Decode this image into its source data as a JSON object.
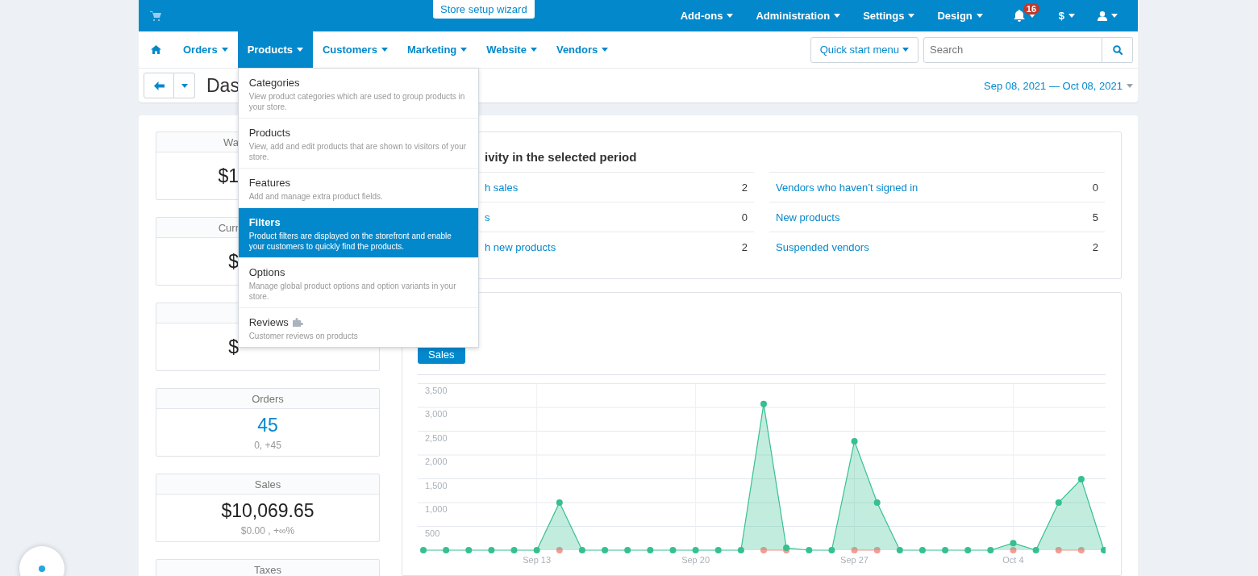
{
  "top_bar": {
    "wizard": "Store setup wizard",
    "menus": [
      {
        "label": "Add-ons"
      },
      {
        "label": "Administration"
      },
      {
        "label": "Settings"
      },
      {
        "label": "Design"
      }
    ],
    "notifications": "16",
    "currency": "$"
  },
  "nav": {
    "items": [
      {
        "label": "Orders",
        "selected": false
      },
      {
        "label": "Products",
        "selected": true
      },
      {
        "label": "Customers",
        "selected": false
      },
      {
        "label": "Marketing",
        "selected": false
      },
      {
        "label": "Website",
        "selected": false
      },
      {
        "label": "Vendors",
        "selected": false
      }
    ],
    "quick_start": "Quick start menu",
    "search": {
      "placeholder": "Search"
    }
  },
  "dropdown": [
    {
      "title": "Categories",
      "description": "View product categories which are used to group products in your store.",
      "selected": false,
      "addon": false
    },
    {
      "title": "Products",
      "description": "View, add and edit products that are shown to visitors of your store.",
      "selected": false,
      "addon": false
    },
    {
      "title": "Features",
      "description": "Add and manage extra product fields.",
      "selected": false,
      "addon": false
    },
    {
      "title": "Filters",
      "description": "Product filters are displayed on the storefront and enable your customers to quickly find the products.",
      "selected": true,
      "addon": false
    },
    {
      "title": "Options",
      "description": "Manage global product options and option variants in your store.",
      "selected": false,
      "addon": false
    },
    {
      "title": "Reviews",
      "description": "Customer reviews on products",
      "selected": false,
      "addon": true
    }
  ],
  "header": {
    "title": "Das",
    "date_range": "Sep 08, 2021 — Oct 08, 2021"
  },
  "stat_cards": [
    {
      "kind": "partial",
      "title": "Wa",
      "value": "$1",
      "link": false
    },
    {
      "kind": "partial",
      "title": "Curr",
      "value": "$",
      "link": false
    },
    {
      "kind": "partial",
      "value": "$",
      "link": false
    },
    {
      "kind": "full",
      "title": "Orders",
      "value": "45",
      "sub": "0, +45",
      "link": true
    },
    {
      "kind": "full",
      "title": "Sales",
      "value": "$10,069.65",
      "sub": "$0.00 , +∞%",
      "link": false
    },
    {
      "kind": "full",
      "title": "Taxes"
    }
  ],
  "activity": {
    "title": "ivity in the selected period",
    "columns": [
      [
        {
          "label": "h sales",
          "value": "2"
        },
        {
          "label": "s",
          "value": "0"
        },
        {
          "label": "h new products",
          "value": "2"
        }
      ],
      [
        {
          "label": "Vendors who haven’t signed in",
          "value": "0"
        },
        {
          "label": "New products",
          "value": "5"
        },
        {
          "label": "Suspended vendors",
          "value": "2"
        }
      ]
    ]
  },
  "chart_panel": {
    "tabs": [
      {
        "label": "Sales",
        "selected": true
      }
    ],
    "chart_data": {
      "type": "area",
      "categories": [
        null,
        null,
        null,
        null,
        null,
        "Sep 13",
        null,
        null,
        null,
        null,
        null,
        null,
        "Sep 20",
        null,
        null,
        null,
        null,
        null,
        null,
        "Sep 27",
        null,
        null,
        null,
        null,
        null,
        null,
        "Oct 4",
        null,
        null,
        null,
        null
      ],
      "ylim": [
        0,
        3500
      ],
      "yticks": [
        500,
        {
          "value": 1000,
          "label": "1,000"
        },
        {
          "value": 1500,
          "label": "1,500"
        },
        {
          "value": 2000,
          "label": "2,000"
        },
        {
          "value": 2500,
          "label": "2,500"
        },
        {
          "value": 3000,
          "label": "3,000"
        },
        {
          "value": 3500,
          "label": "3,500"
        }
      ],
      "grid": true,
      "series": [
        {
          "color": "#35c08f",
          "marker": true,
          "values": [
            0,
            0,
            0,
            0,
            0,
            0,
            1000,
            0,
            0,
            0,
            0,
            0,
            0,
            0,
            0,
            3070,
            50,
            0,
            0,
            2290,
            1000,
            0,
            0,
            0,
            0,
            0,
            150,
            0,
            1000,
            1490,
            0
          ]
        },
        {
          "type": "line",
          "color": "#f79a94",
          "marker": true,
          "values": [
            null,
            null,
            null,
            null,
            null,
            null,
            0,
            null,
            null,
            null,
            null,
            null,
            null,
            null,
            null,
            0,
            0,
            null,
            null,
            0,
            0,
            null,
            null,
            null,
            null,
            null,
            0,
            null,
            0,
            0,
            null
          ]
        }
      ]
    }
  }
}
